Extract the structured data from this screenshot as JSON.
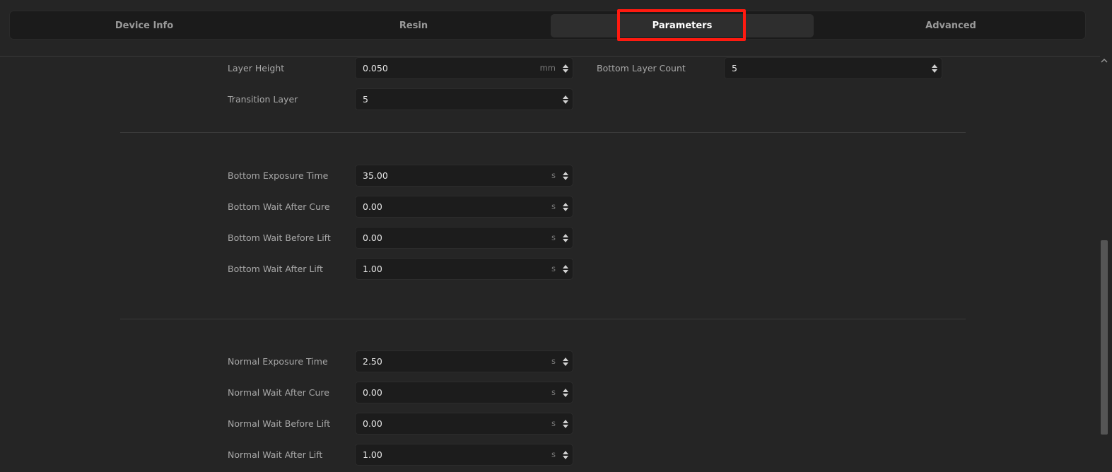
{
  "tabs": [
    {
      "label": "Device Info"
    },
    {
      "label": "Resin"
    },
    {
      "label": "Parameters"
    },
    {
      "label": "Advanced"
    }
  ],
  "active_tab": "Parameters",
  "layer": {
    "layer_height": {
      "label": "Layer Height",
      "value": "0.050",
      "unit": "mm"
    },
    "bottom_layer_count": {
      "label": "Bottom Layer Count",
      "value": "5"
    },
    "transition_layer": {
      "label": "Transition Layer",
      "value": "5"
    }
  },
  "bottom": {
    "exposure_time": {
      "label": "Bottom Exposure Time",
      "value": "35.00",
      "unit": "s"
    },
    "wait_after_cure": {
      "label": "Bottom Wait After Cure",
      "value": "0.00",
      "unit": "s"
    },
    "wait_before_lift": {
      "label": "Bottom Wait Before Lift",
      "value": "0.00",
      "unit": "s"
    },
    "wait_after_lift": {
      "label": "Bottom Wait After Lift",
      "value": "1.00",
      "unit": "s"
    }
  },
  "normal": {
    "exposure_time": {
      "label": "Normal Exposure Time",
      "value": "2.50",
      "unit": "s"
    },
    "wait_after_cure": {
      "label": "Normal Wait After Cure",
      "value": "0.00",
      "unit": "s"
    },
    "wait_before_lift": {
      "label": "Normal Wait Before Lift",
      "value": "0.00",
      "unit": "s"
    },
    "wait_after_lift": {
      "label": "Normal Wait After Lift",
      "value": "1.00",
      "unit": "s"
    }
  },
  "icons": {
    "spin_arrows": "spin-updown-icon",
    "scroll_up": "chevron-up-icon"
  },
  "colors": {
    "background": "#252525",
    "highlight": "#ff1a10",
    "field_bg": "#1c1c1c"
  }
}
